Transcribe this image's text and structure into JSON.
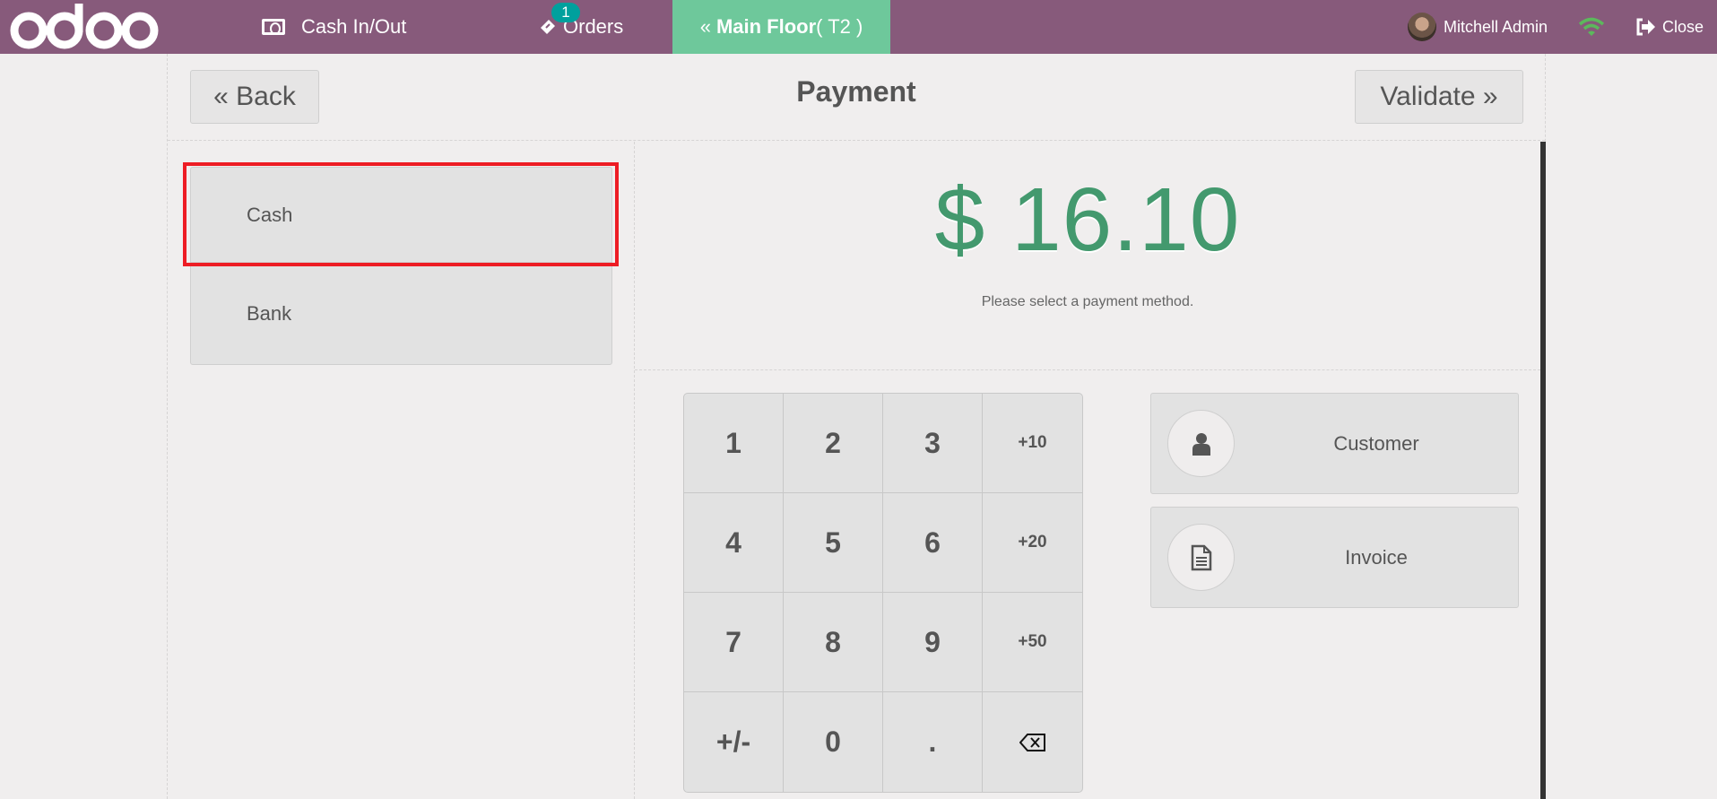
{
  "header": {
    "logo": "odoo",
    "cash_in_out": "Cash In/Out",
    "orders_label": "Orders",
    "orders_badge": "1",
    "floor_prefix": "Main Floor",
    "floor_table": "( T2 )",
    "user_name": "Mitchell Admin",
    "close_label": "Close",
    "colors": {
      "bar": "#875a7b",
      "floor_tab": "#6ec89b",
      "badge": "#00a09d",
      "wifi": "#5cb85c"
    }
  },
  "topbar": {
    "back_label": "« Back",
    "title": "Payment",
    "validate_label": "Validate »"
  },
  "payment_methods": [
    {
      "label": "Cash",
      "highlighted": true
    },
    {
      "label": "Bank",
      "highlighted": false
    }
  ],
  "summary": {
    "amount": "$ 16.10",
    "hint": "Please select a payment method.",
    "amount_color": "#43996e"
  },
  "keypad": {
    "keys": [
      "1",
      "2",
      "3",
      "+10",
      "4",
      "5",
      "6",
      "+20",
      "7",
      "8",
      "9",
      "+50",
      "+/-",
      "0",
      ".",
      "backspace"
    ]
  },
  "actions": {
    "customer": "Customer",
    "invoice": "Invoice"
  }
}
